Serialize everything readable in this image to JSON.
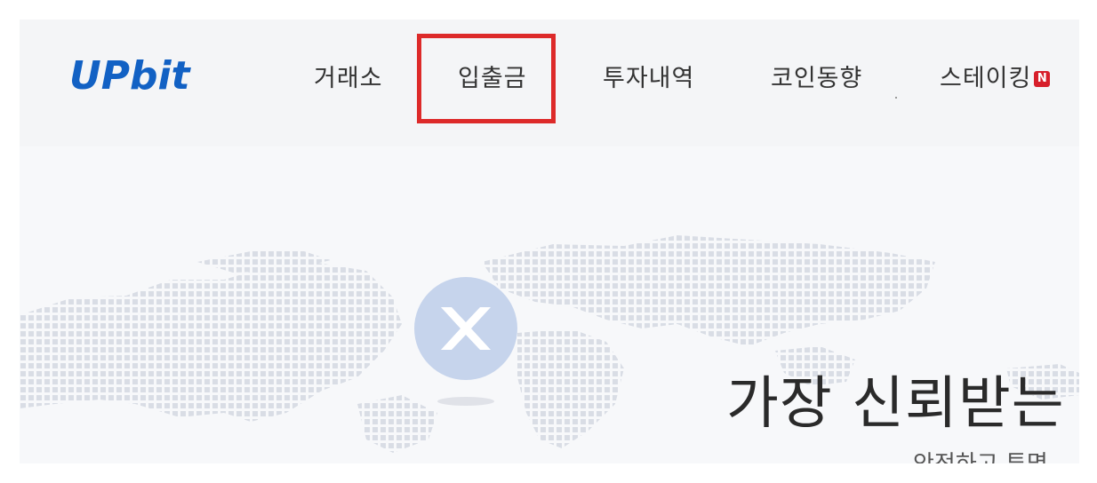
{
  "header": {
    "logo_text": "UPbit",
    "nav": [
      {
        "label": "거래소"
      },
      {
        "label": "입출금"
      },
      {
        "label": "투자내역"
      },
      {
        "label": "코인동향"
      },
      {
        "label": "스테이킹",
        "badge": "N"
      }
    ],
    "highlighted_item": "입출금"
  },
  "hero": {
    "title": "가장 신뢰받는",
    "subtitle": "안전하고 투명"
  },
  "colors": {
    "brand_blue": "#1261c4",
    "highlight_red": "#dd2a2a",
    "badge_red": "#d71f2b"
  },
  "icons": {
    "coin": "xrp-coin-icon",
    "map": "world-map-dots"
  }
}
